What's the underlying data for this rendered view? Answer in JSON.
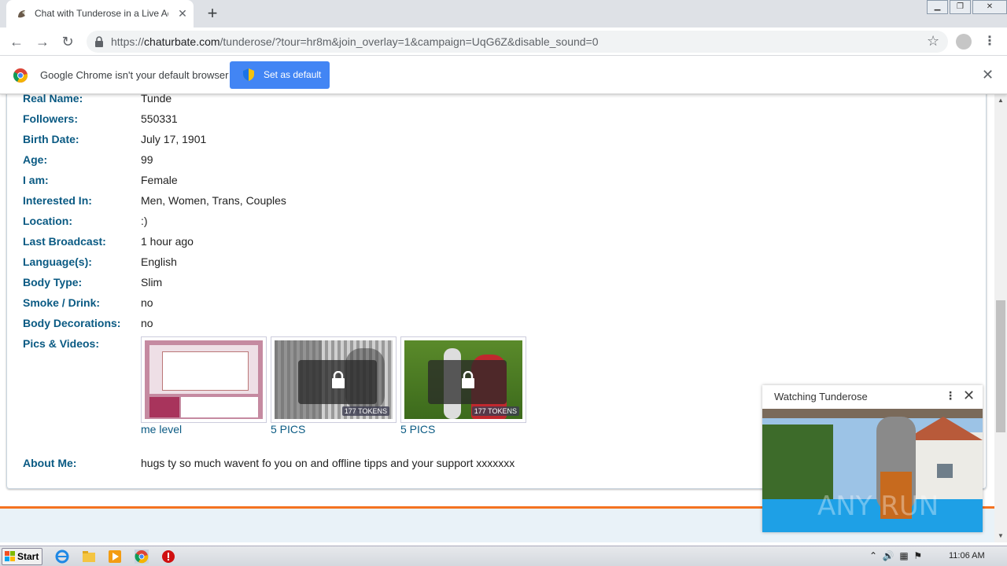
{
  "browser": {
    "tab_title": "Chat with Tunderose in a Live Adult",
    "url_scheme": "https://",
    "url_host": "chaturbate.com",
    "url_path": "/tunderose/?tour=hr8m&join_overlay=1&campaign=UqG6Z&disable_sound=0",
    "infobar_text": "Google Chrome isn't your default browser",
    "set_default_label": "Set as default"
  },
  "profile": {
    "rows": [
      {
        "label": "Real Name:",
        "value": "Tunde"
      },
      {
        "label": "Followers:",
        "value": "550331"
      },
      {
        "label": "Birth Date:",
        "value": "July 17, 1901"
      },
      {
        "label": "Age:",
        "value": "99"
      },
      {
        "label": "I am:",
        "value": "Female"
      },
      {
        "label": "Interested In:",
        "value": "Men, Women, Trans, Couples"
      },
      {
        "label": "Location:",
        "value": ":)"
      },
      {
        "label": "Last Broadcast:",
        "value": "1 hour ago"
      },
      {
        "label": "Language(s):",
        "value": "English"
      },
      {
        "label": "Body Type:",
        "value": "Slim"
      },
      {
        "label": "Smoke / Drink:",
        "value": "no"
      },
      {
        "label": "Body Decorations:",
        "value": "no"
      }
    ],
    "pics_label": "Pics & Videos:",
    "pics": [
      {
        "caption": "me level",
        "tokens": ""
      },
      {
        "caption": "5 PICS",
        "tokens": "177 TOKENS"
      },
      {
        "caption": "5 PICS",
        "tokens": "177 TOKENS"
      }
    ],
    "about_label": "About Me:",
    "about_value": "hugs ty so much wavent fo you on and offline tipps and your support xxxxxxx"
  },
  "watch_popup": {
    "title": "Watching Tunderose",
    "watermark": "ANY RUN"
  },
  "taskbar": {
    "start_label": "Start",
    "clock": "11:06 AM"
  },
  "colors": {
    "accent_blue": "#4285f4",
    "label_blue": "#0a5a83",
    "orange": "#f47321"
  }
}
